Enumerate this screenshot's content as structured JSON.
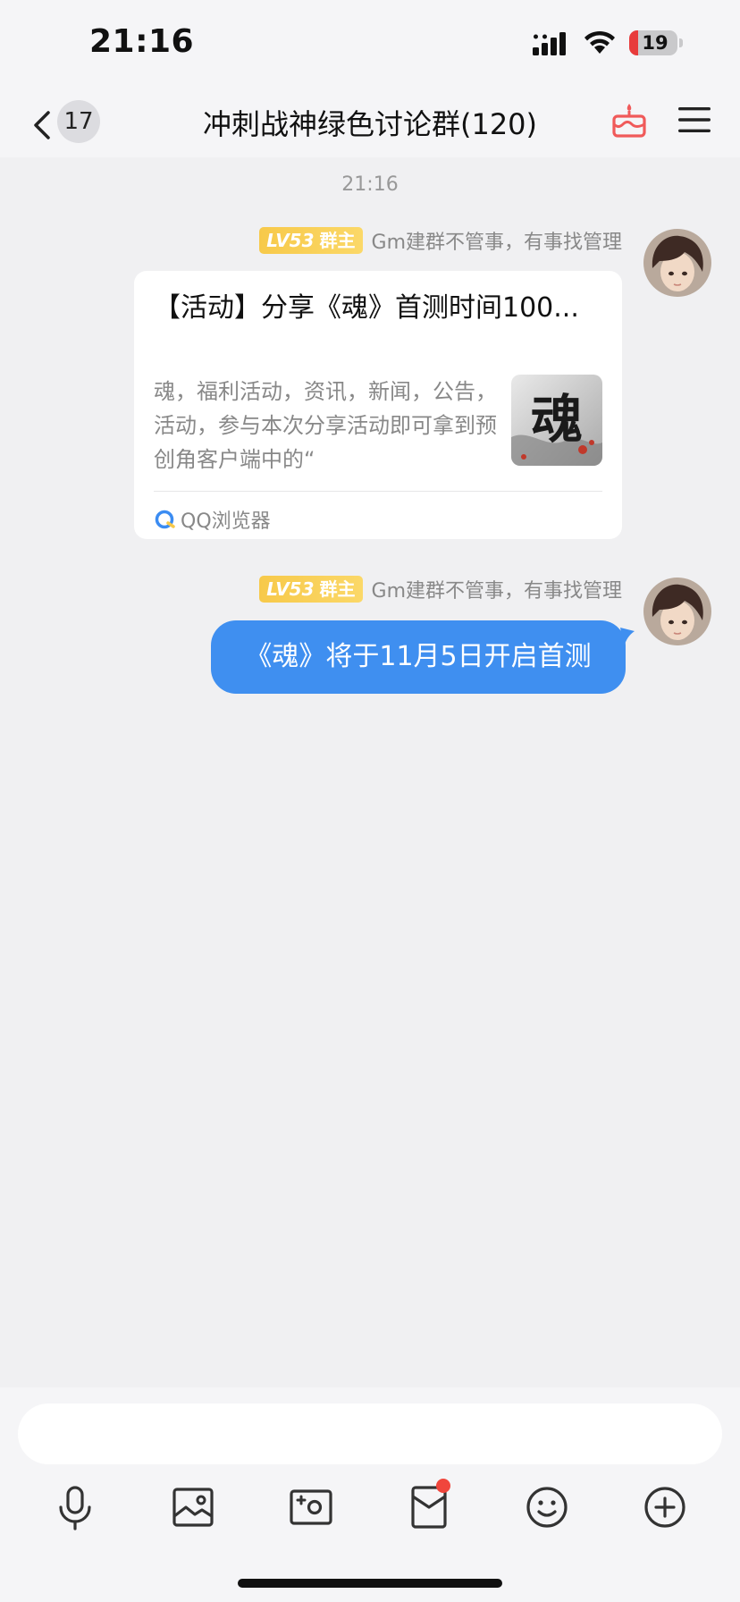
{
  "status_bar": {
    "time": "21:16",
    "battery": "19",
    "battery_level": 0.19,
    "battery_color": "#e83b3b"
  },
  "nav": {
    "unread_count": "17",
    "title": "冲刺战神绿色讨论群(120)"
  },
  "chat": {
    "timestamp": "21:16",
    "messages": [
      {
        "level": "LV53",
        "role": "群主",
        "sender": "Gm建群不管事，有事找管理",
        "card": {
          "title": "【活动】分享《魂》首测时间100...",
          "description": "魂，福利活动，资讯，新闻，公告，活动，参与本次分享活动即可拿到预创角客户端中的“",
          "thumb_text": "魂",
          "source": "QQ浏览器"
        }
      },
      {
        "level": "LV53",
        "role": "群主",
        "sender": "Gm建群不管事，有事找管理",
        "text": "《魂》将于11月5日开启首测"
      }
    ]
  },
  "colors": {
    "bubble": "#3f8ff0",
    "level_tag": "#f7c94a",
    "cake_icon": "#f05a5a",
    "badge_dot": "#f0463c"
  },
  "toolbar": {
    "icons": [
      "microphone-icon",
      "photo-album-icon",
      "camera-icon",
      "red-packet-icon",
      "emoji-icon",
      "plus-circle-icon"
    ]
  }
}
